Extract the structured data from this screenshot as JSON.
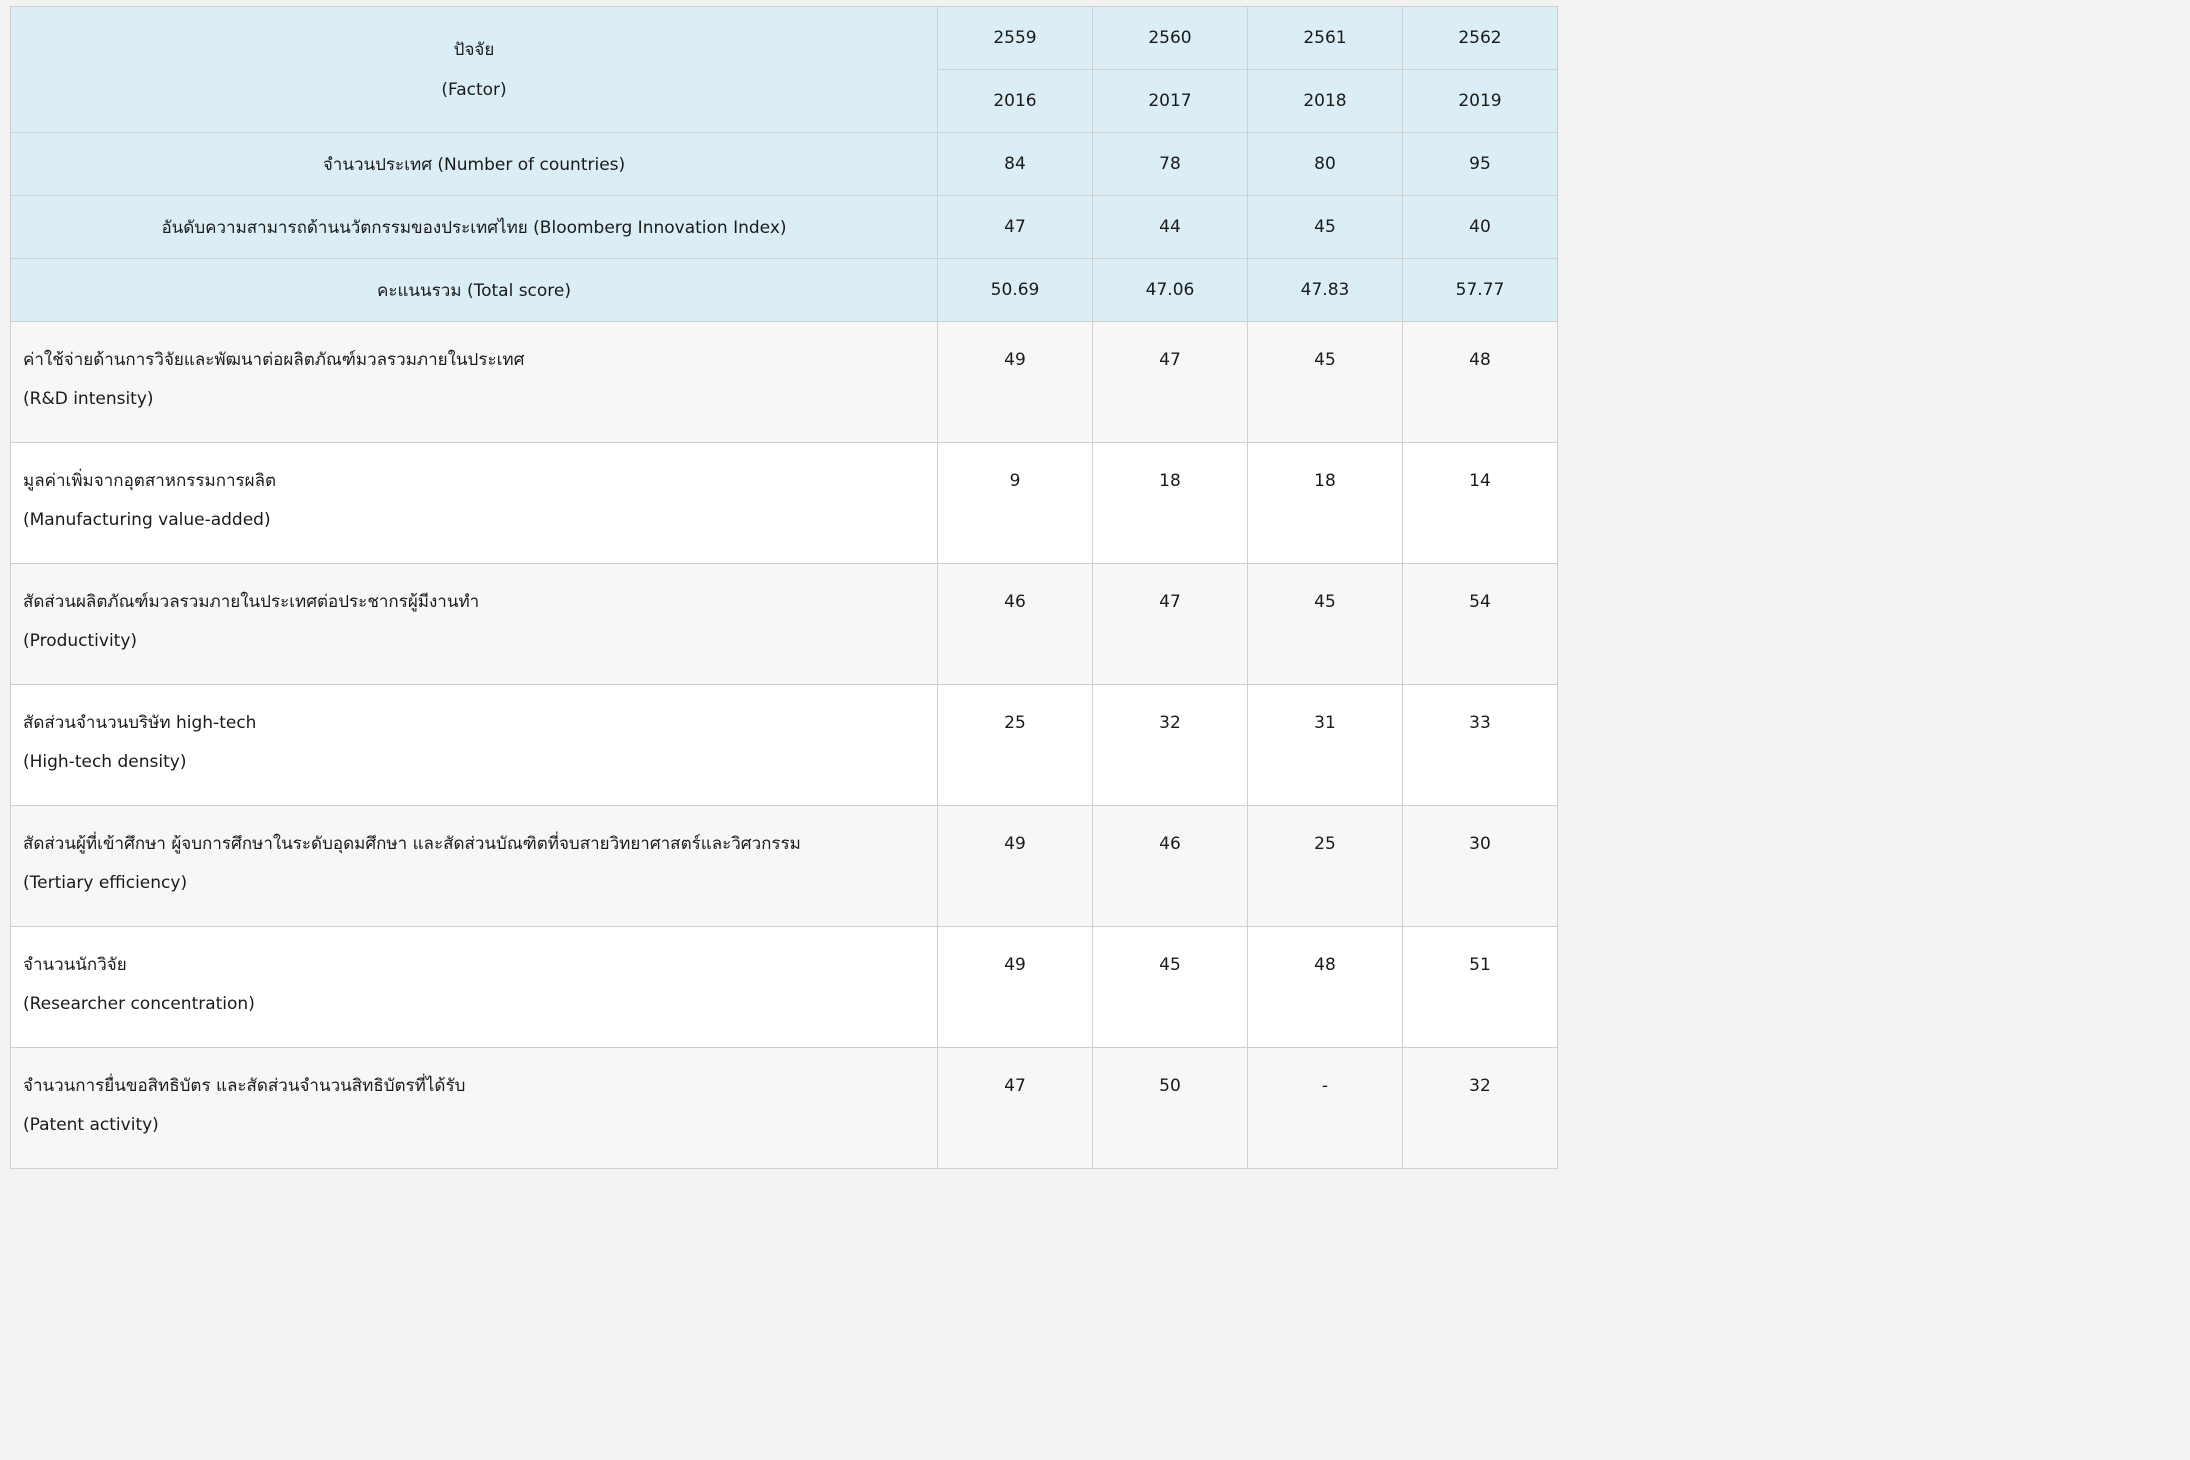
{
  "header": {
    "factor_th": "ปัจจัย",
    "factor_en": "(Factor)",
    "years_be": [
      "2559",
      "2560",
      "2561",
      "2562"
    ],
    "years_ce": [
      "2016",
      "2017",
      "2018",
      "2019"
    ]
  },
  "summary_rows": [
    {
      "label": "จำนวนประเทศ (Number of countries)",
      "values": [
        "84",
        "78",
        "80",
        "95"
      ]
    },
    {
      "label": "อันดับความสามารถด้านนวัตกรรมของประเทศไทย (Bloomberg Innovation Index)",
      "values": [
        "47",
        "44",
        "45",
        "40"
      ]
    },
    {
      "label": "คะแนนรวม (Total score)",
      "values": [
        "50.69",
        "47.06",
        "47.83",
        "57.77"
      ]
    }
  ],
  "detail_rows": [
    {
      "label_th": "ค่าใช้จ่ายด้านการวิจัยและพัฒนาต่อผลิตภัณฑ์มวลรวมภายในประเทศ",
      "label_en": "(R&D intensity)",
      "values": [
        "49",
        "47",
        "45",
        "48"
      ]
    },
    {
      "label_th": "มูลค่าเพิ่มจากอุตสาหกรรมการผลิต",
      "label_en": "(Manufacturing value-added)",
      "values": [
        "9",
        "18",
        "18",
        "14"
      ]
    },
    {
      "label_th": "สัดส่วนผลิตภัณฑ์มวลรวมภายในประเทศต่อประชากรผู้มีงานทำ",
      "label_en": "(Productivity)",
      "values": [
        "46",
        "47",
        "45",
        "54"
      ]
    },
    {
      "label_th": "สัดส่วนจำนวนบริษัท high-tech",
      "label_en": "(High-tech density)",
      "values": [
        "25",
        "32",
        "31",
        "33"
      ]
    },
    {
      "label_th": "สัดส่วนผู้ที่เข้าศึกษา ผู้จบการศึกษาในระดับอุดมศึกษา และสัดส่วนบัณฑิตที่จบสายวิทยาศาสตร์และวิศวกรรม",
      "label_en": "(Tertiary efficiency)",
      "values": [
        "49",
        "46",
        "25",
        "30"
      ]
    },
    {
      "label_th": "จำนวนนักวิจัย",
      "label_en": "(Researcher concentration)",
      "values": [
        "49",
        "45",
        "48",
        "51"
      ]
    },
    {
      "label_th": "จำนวนการยื่นขอสิทธิบัตร และสัดส่วนจำนวนสิทธิบัตรที่ได้รับ",
      "label_en": "(Patent activity)",
      "values": [
        "47",
        "50",
        "-",
        "32"
      ]
    }
  ],
  "colors": {
    "header_bg": "#dbedf5",
    "row_bg": "#ffffff",
    "row_alt_bg": "#f7f7f7",
    "border": "#cfcfcf",
    "page_bg": "#f2f2f2"
  }
}
